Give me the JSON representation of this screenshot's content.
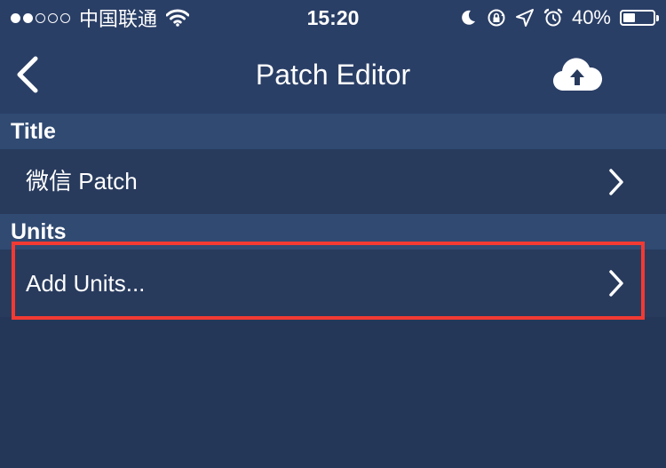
{
  "status_bar": {
    "signal_dots_filled": 2,
    "signal_dots_total": 5,
    "carrier": "中国联通",
    "time": "15:20",
    "battery_percent": "40%",
    "battery_level": 0.4,
    "icons": [
      "signal-dots",
      "wifi-icon",
      "moon-icon",
      "rotation-lock-icon",
      "location-arrow-icon",
      "alarm-clock-icon",
      "battery-icon"
    ]
  },
  "navbar": {
    "title": "Patch Editor",
    "back_icon": "chevron-left-icon",
    "upload_icon": "cloud-upload-icon"
  },
  "sections": {
    "title_header": "Title",
    "title_row_value": "微信 Patch",
    "units_header": "Units",
    "units_row_label": "Add Units..."
  },
  "colors": {
    "background": "#243759",
    "navbar": "#2a3f66",
    "section_header": "#304a72",
    "row": "#283b5d",
    "highlight": "#f23a33",
    "text": "#ffffff"
  }
}
